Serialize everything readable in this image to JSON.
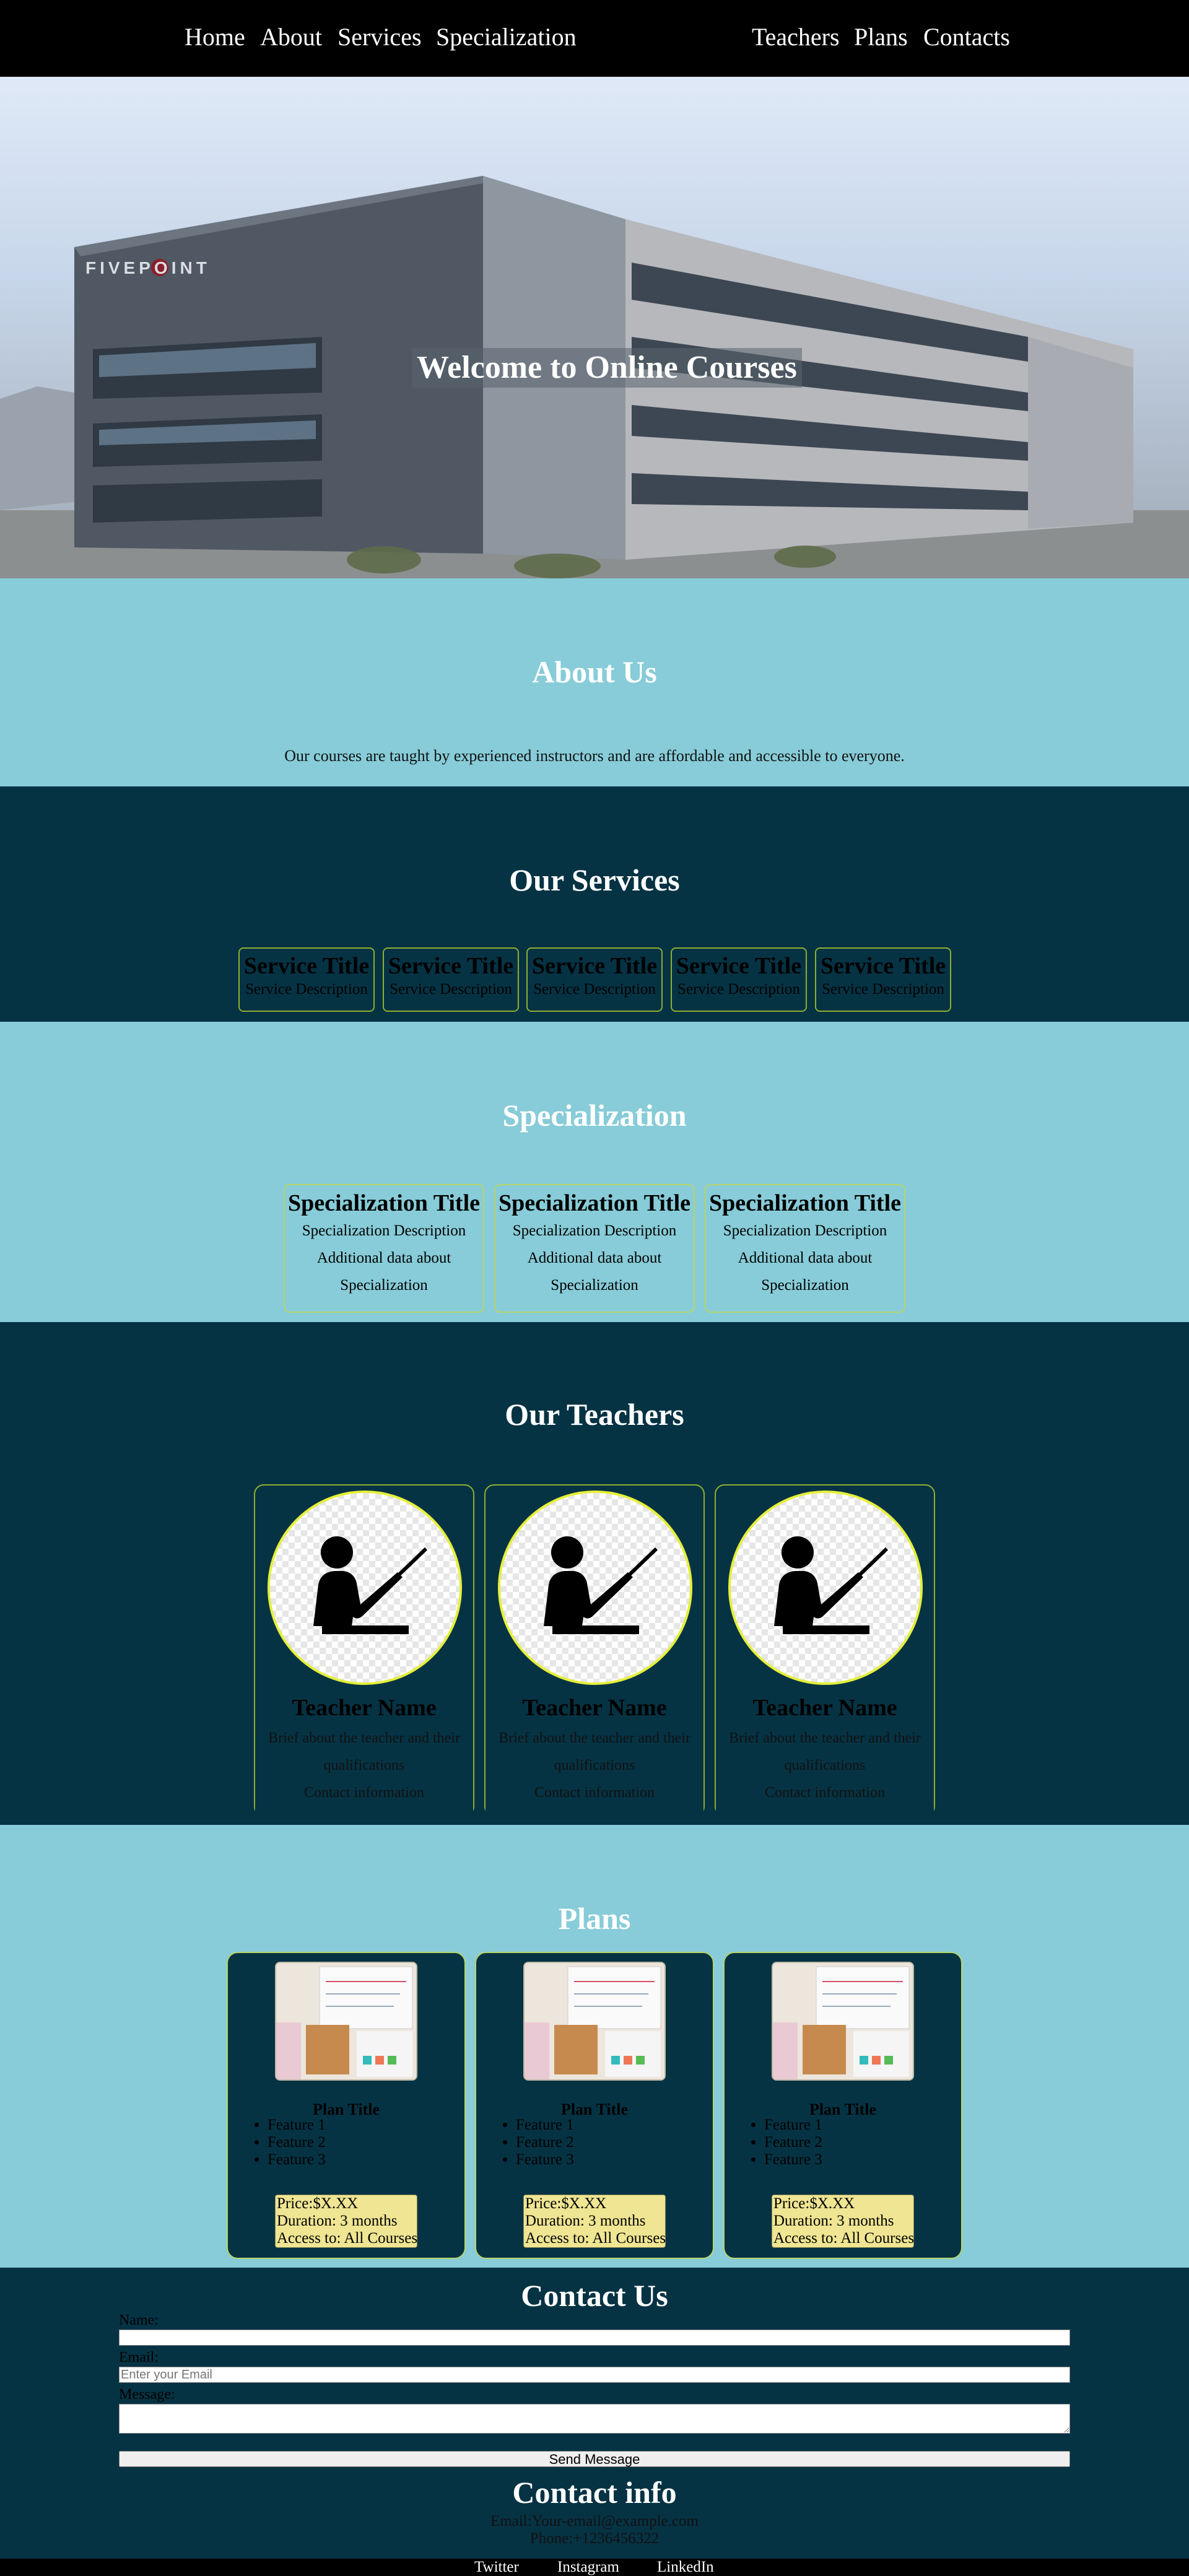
{
  "nav": {
    "links": [
      "Home",
      "About",
      "Services",
      "Specialization",
      "Teachers",
      "Plans",
      "Contacts"
    ]
  },
  "hero": {
    "title": "Welcome to Online Courses",
    "building_sign": "FIVEPOINT"
  },
  "about": {
    "title": "About Us",
    "text": "Our courses are taught by experienced instructors and are affordable and accessible to everyone."
  },
  "services": {
    "title": "Our Services",
    "items": [
      {
        "title": "Service Title",
        "desc": "Service Description"
      },
      {
        "title": "Service Title",
        "desc": "Service Description"
      },
      {
        "title": "Service Title",
        "desc": "Service Description"
      },
      {
        "title": "Service Title",
        "desc": "Service Description"
      },
      {
        "title": "Service Title",
        "desc": "Service Description"
      }
    ]
  },
  "specialization": {
    "title": "Specialization",
    "items": [
      {
        "title": "Specialization Title",
        "desc": "Specialization Description Additional data about Specialization"
      },
      {
        "title": "Specialization Title",
        "desc": "Specialization Description Additional data about Specialization"
      },
      {
        "title": "Specialization Title",
        "desc": "Specialization Description Additional data about Specialization"
      }
    ]
  },
  "teachers": {
    "title": "Our Teachers",
    "items": [
      {
        "name": "Teacher Name",
        "bio": "Brief about the teacher and their qualifications",
        "contact": "Contact information",
        "icon": "teacher-icon"
      },
      {
        "name": "Teacher Name",
        "bio": "Brief about the teacher and their qualifications",
        "contact": "Contact information",
        "icon": "teacher-icon"
      },
      {
        "name": "Teacher Name",
        "bio": "Brief about the teacher and their qualifications",
        "contact": "Contact information",
        "icon": "teacher-icon"
      }
    ]
  },
  "plans": {
    "title": "Plans",
    "items": [
      {
        "title": "Plan Title",
        "features": [
          "Feature 1",
          "Feature 2",
          "Feature 3"
        ],
        "price": "Price:$X.XX",
        "duration": "Duration: 3 months",
        "access": "Access to: All Courses"
      },
      {
        "title": "Plan Title",
        "features": [
          "Feature 1",
          "Feature 2",
          "Feature 3"
        ],
        "price": "Price:$X.XX",
        "duration": "Duration: 3 months",
        "access": "Access to: All Courses"
      },
      {
        "title": "Plan Title",
        "features": [
          "Feature 1",
          "Feature 2",
          "Feature 3"
        ],
        "price": "Price:$X.XX",
        "duration": "Duration: 3 months",
        "access": "Access to: All Courses"
      }
    ]
  },
  "contact": {
    "title": "Contact Us",
    "name_label": "Name:",
    "name_value": "",
    "email_label": "Email:",
    "email_placeholder": "Enter your Email",
    "message_label": "Message:",
    "message_value": "",
    "submit_label": "Send Message",
    "info_title": "Contact info",
    "email_line": "Email:Your-email@example.com",
    "phone_line": "Phone:+1236456322"
  },
  "footer": {
    "links": [
      "Twitter",
      "Instagram",
      "LinkedIn"
    ]
  },
  "colors": {
    "dark_teal": "#053344",
    "light_teal": "#87ccd8",
    "card_border": "#8fae2e",
    "price_bg": "#efe592",
    "avatar_ring": "#e5ef3a"
  }
}
